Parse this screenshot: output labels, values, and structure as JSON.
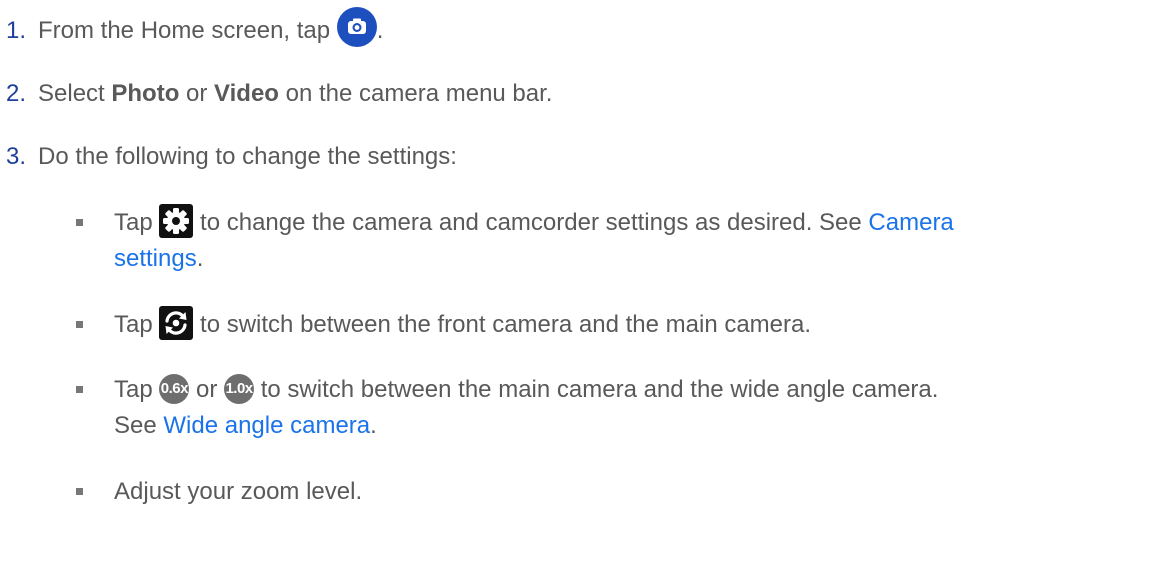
{
  "steps": [
    {
      "number": "1.",
      "text_before": "From the Home screen, tap ",
      "text_after": ".",
      "icon": "camera-app-icon"
    },
    {
      "number": "2.",
      "text_prefix": "Select ",
      "bold1": "Photo",
      "text_mid": " or ",
      "bold2": "Video",
      "text_suffix": " on the camera menu bar."
    },
    {
      "number": "3.",
      "text": "Do the following to change the settings:"
    }
  ],
  "bullets": {
    "settings": {
      "before": "Tap ",
      "icon": "gear-icon",
      "after": " to change the camera and camcorder settings as desired. See ",
      "link_line1": "Camera",
      "link_line2": "settings",
      "end": "."
    },
    "switch": {
      "before": "Tap ",
      "icon": "switch-camera-icon",
      "after": " to switch between the front camera and the main camera."
    },
    "zoom_switch": {
      "before": "Tap ",
      "pill1": "0.6x",
      "mid": " or ",
      "pill2": "1.0x",
      "after": " to switch between the main camera and the wide angle camera.",
      "see": "See ",
      "link": "Wide angle camera",
      "end": "."
    },
    "adjust": {
      "text": "Adjust your zoom level."
    }
  },
  "colors": {
    "text": "#595959",
    "number": "#1f3f9a",
    "link": "#1a73e8",
    "camera_icon": "#1e4fbf",
    "pill": "#6e6e6e"
  }
}
